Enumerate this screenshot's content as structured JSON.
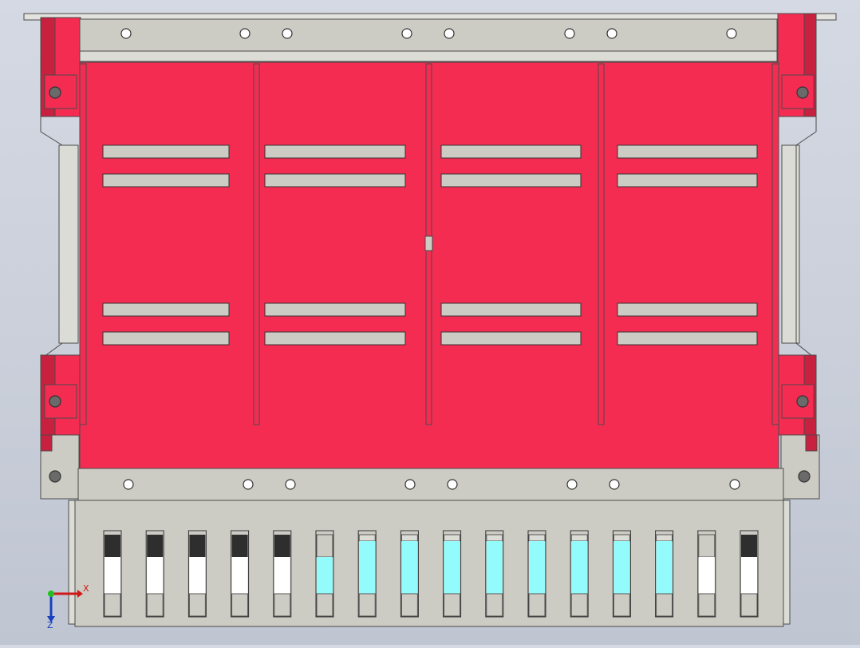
{
  "app": {
    "title": ""
  },
  "model": {
    "bay_count": 4,
    "vent_slot_count": 16,
    "colors": {
      "background": "#cfd3dd",
      "housing_red": "#f42c52",
      "housing_red_dark": "#c8203f",
      "sheet_metal": "#cdccc4",
      "edge": "#4a4a4a",
      "slot_dark": "#2e2e2e",
      "slot_white": "#ffffff",
      "slot_cyan": "#93fbfb"
    },
    "vent_slots": [
      "dark",
      "dark",
      "dark",
      "dark",
      "dark",
      "part",
      "cyan",
      "cyan",
      "cyan",
      "cyan",
      "cyan",
      "cyan",
      "cyan",
      "cyan",
      "part",
      "dark"
    ]
  },
  "triad": {
    "x_label": "X",
    "z_label": "Z",
    "icon": "coordinate-triad-icon"
  }
}
